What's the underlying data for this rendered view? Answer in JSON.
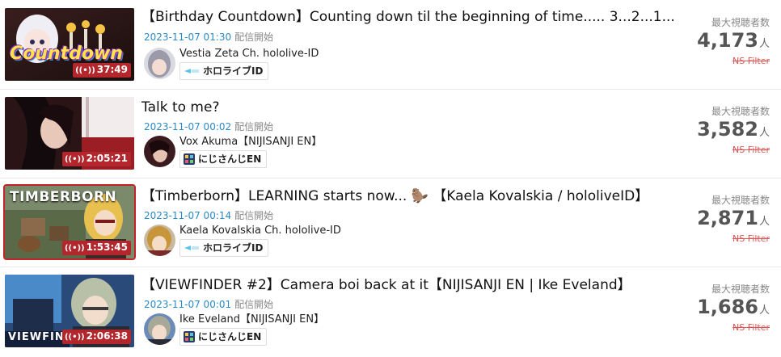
{
  "items": [
    {
      "title": "【Birthday Countdown】Counting down til the beginning of time..... 3...2...1...",
      "datetime": "2023-11-07 01:30",
      "start_label": "配信開始",
      "channel": "Vestia Zeta Ch. hololive-ID",
      "agency": "ホロライブID",
      "agency_icon": "hololive-logo-icon",
      "duration": "37:49",
      "thumb_text": "Countdown",
      "stat_label": "最大視聴者数",
      "viewers": "4,173",
      "unit": "人",
      "filter": "NS Filter"
    },
    {
      "title": "Talk to me?",
      "datetime": "2023-11-07 00:02",
      "start_label": "配信開始",
      "channel": "Vox Akuma【NIJISANJI EN】",
      "agency": "にじさんじEN",
      "agency_icon": "nijisanji-logo-icon",
      "duration": "2:05:21",
      "thumb_text": "",
      "stat_label": "最大視聴者数",
      "viewers": "3,582",
      "unit": "人",
      "filter": "NS Filter"
    },
    {
      "title": "【Timberborn】LEARNING starts now... 🦫 【Kaela Kovalskia / hololiveID】",
      "datetime": "2023-11-07 00:14",
      "start_label": "配信開始",
      "channel": "Kaela Kovalskia Ch. hololive-ID",
      "agency": "ホロライブID",
      "agency_icon": "hololive-logo-icon",
      "duration": "1:53:45",
      "thumb_text": "TIMBERBORN",
      "stat_label": "最大視聴者数",
      "viewers": "2,871",
      "unit": "人",
      "filter": "NS Filter"
    },
    {
      "title": "【VIEWFINDER #2】Camera boi back at it【NIJISANJI EN | Ike Eveland】",
      "datetime": "2023-11-07 00:01",
      "start_label": "配信開始",
      "channel": "Ike Eveland【NIJISANJI EN】",
      "agency": "にじさんじEN",
      "agency_icon": "nijisanji-logo-icon",
      "duration": "2:06:38",
      "thumb_text": "VIEWFINDE",
      "stat_label": "最大視聴者数",
      "viewers": "1,686",
      "unit": "人",
      "filter": "NS Filter"
    }
  ],
  "colors": {
    "duration_badge": "#b3262b",
    "date_link": "#2b8ac6",
    "ns_filter": "#dd5555",
    "viewer_count": "#555555"
  }
}
